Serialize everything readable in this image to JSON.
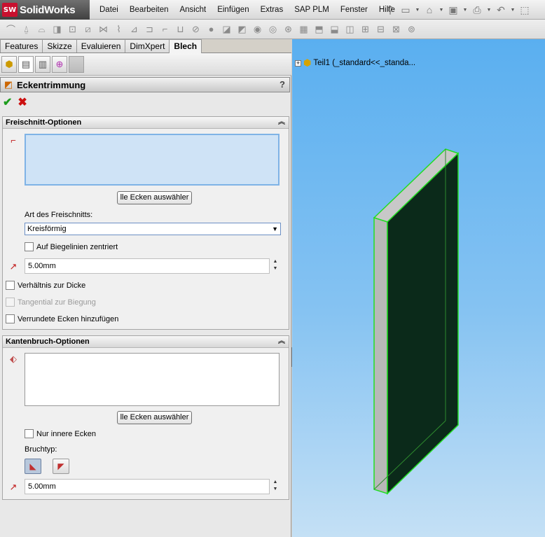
{
  "app": {
    "logo_badge": "SW",
    "logo_name": "SolidWorks"
  },
  "menu": [
    "Datei",
    "Bearbeiten",
    "Ansicht",
    "Einfügen",
    "Extras",
    "SAP PLM",
    "Fenster",
    "Hilfe"
  ],
  "command_tabs": [
    "Features",
    "Skizze",
    "Evaluieren",
    "DimXpert",
    "Blech"
  ],
  "active_command_tab": "Blech",
  "property_manager": {
    "title": "Eckentrimmung",
    "help": "?"
  },
  "relief_options": {
    "header": "Freischnitt-Optionen",
    "select_all_button": "lle Ecken auswähler",
    "type_label": "Art des Freischnitts:",
    "type_value": "Kreisförmig",
    "center_on_bend_lines": "Auf Biegelinien zentriert",
    "dimension_value": "5.00mm",
    "ratio_to_thickness": "Verhältnis zur Dicke",
    "tangent_to_bend": "Tangential zur Biegung",
    "add_filleted_corners": "Verrundete Ecken hinzufügen"
  },
  "break_options": {
    "header": "Kantenbruch-Optionen",
    "select_all_button": "lle Ecken auswähler",
    "inner_corners_only": "Nur innere Ecken",
    "break_type_label": "Bruchtyp:",
    "dimension_value": "5.00mm"
  },
  "tree": {
    "root_label": "Teil1  (_standard<<_standa..."
  },
  "colors": {
    "viewport_top": "#5aaff0",
    "viewport_bottom": "#c4e0f5",
    "model_face": "#0b2a1a",
    "model_edge": "#22dd22",
    "model_side": "#c0c0c0"
  }
}
